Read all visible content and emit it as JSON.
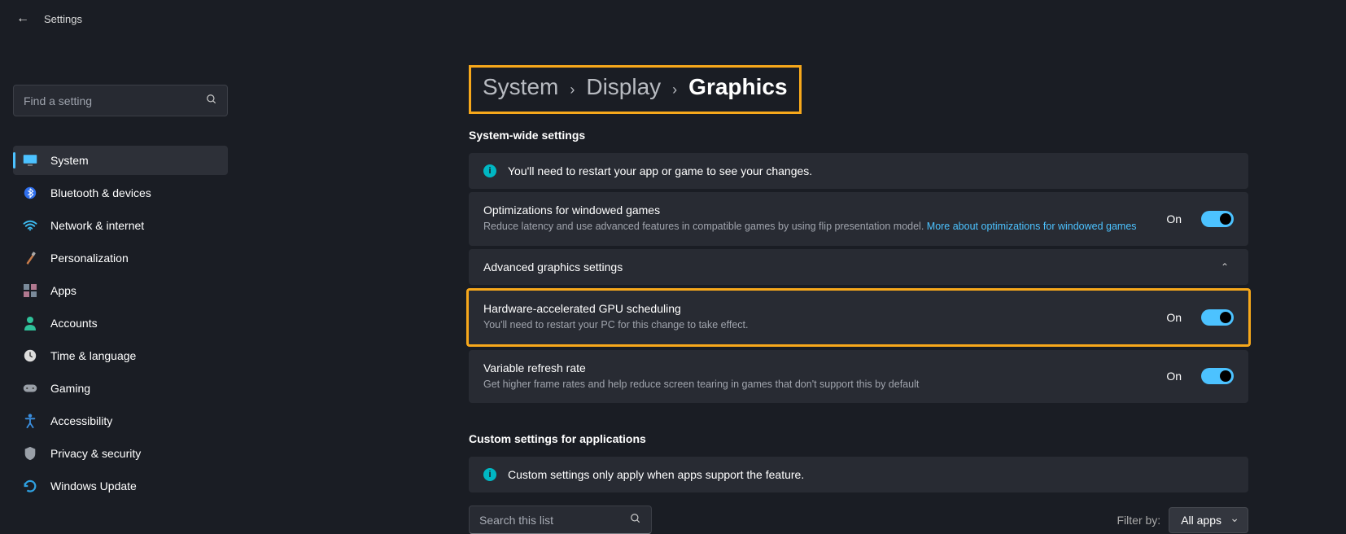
{
  "app": {
    "title": "Settings"
  },
  "search": {
    "placeholder": "Find a setting"
  },
  "nav": {
    "items": [
      {
        "label": "System"
      },
      {
        "label": "Bluetooth & devices"
      },
      {
        "label": "Network & internet"
      },
      {
        "label": "Personalization"
      },
      {
        "label": "Apps"
      },
      {
        "label": "Accounts"
      },
      {
        "label": "Time & language"
      },
      {
        "label": "Gaming"
      },
      {
        "label": "Accessibility"
      },
      {
        "label": "Privacy & security"
      },
      {
        "label": "Windows Update"
      }
    ]
  },
  "breadcrumb": {
    "a": "System",
    "b": "Display",
    "c": "Graphics"
  },
  "sections": {
    "systemwide": "System-wide settings",
    "customapps": "Custom settings for applications"
  },
  "cards": {
    "restart_app": "You'll need to restart your app or game to see your changes.",
    "opt_title": "Optimizations for windowed games",
    "opt_desc": "Reduce latency and use advanced features in compatible games by using flip presentation model.  ",
    "opt_link": "More about optimizations for windowed games",
    "opt_state": "On",
    "advanced_title": "Advanced graphics settings",
    "gpu_title": "Hardware-accelerated GPU scheduling",
    "gpu_desc": "You'll need to restart your PC for this change to take effect.",
    "gpu_state": "On",
    "vrr_title": "Variable refresh rate",
    "vrr_desc": "Get higher frame rates and help reduce screen tearing in games that don't support this by default",
    "vrr_state": "On",
    "custom_info": "Custom settings only apply when apps support the feature."
  },
  "list_search": {
    "placeholder": "Search this list"
  },
  "filter": {
    "label": "Filter by:",
    "selected": "All apps"
  }
}
